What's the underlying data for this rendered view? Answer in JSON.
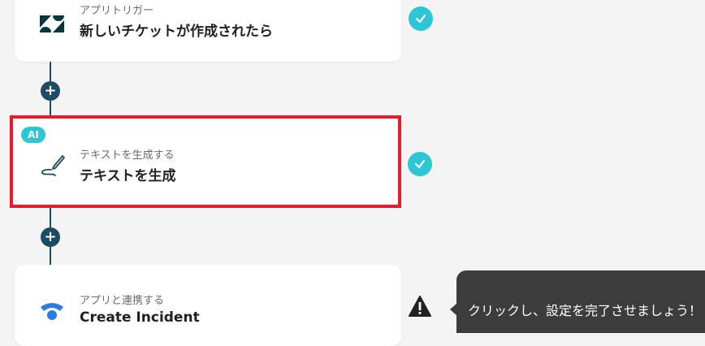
{
  "steps": [
    {
      "kind": "app-trigger",
      "subtitle": "アプリトリガー",
      "title": "新しいチケットが作成されたら",
      "icon": "zendesk-logo-icon",
      "status": "completed"
    },
    {
      "kind": "ai-action",
      "badge": "AI",
      "subtitle": "テキストを生成する",
      "title": "テキストを生成",
      "icon": "pen-icon",
      "status": "completed",
      "highlighted": true
    },
    {
      "kind": "app-action",
      "subtitle": "アプリと連携する",
      "title": "Create Incident",
      "icon": "statuspage-logo-icon",
      "status": "warning"
    }
  ],
  "add_step_label": "+",
  "tooltip": {
    "text": "クリックし、設定を完了させましょう！"
  },
  "colors": {
    "connector": "#1d4b66",
    "check": "#2ec5d5",
    "highlight": "#e0202a",
    "tooltip_bg": "#3c3c3c",
    "zendesk": "#03363d",
    "statuspage": "#2f7be5"
  }
}
